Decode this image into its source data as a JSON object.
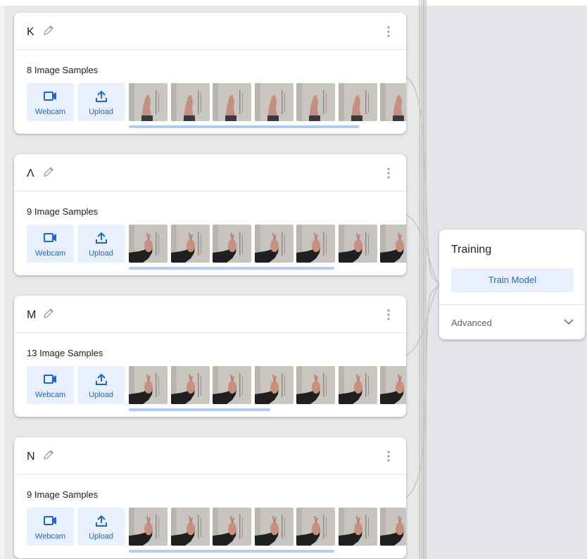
{
  "classes": [
    {
      "name": "K",
      "samples_label": "8 Image Samples",
      "webcam_label": "Webcam",
      "upload_label": "Upload",
      "thumb_count": 7,
      "scroll_progress": 0.83,
      "thumb_bg": "#c9c6c2",
      "sleeve": "#3a3a3a"
    },
    {
      "name": "Λ",
      "samples_label": "9 Image Samples",
      "webcam_label": "Webcam",
      "upload_label": "Upload",
      "thumb_count": 7,
      "scroll_progress": 0.74,
      "thumb_bg": "#c7c4bf",
      "sleeve": "#1f1f1f"
    },
    {
      "name": "M",
      "samples_label": "13 Image Samples",
      "webcam_label": "Webcam",
      "upload_label": "Upload",
      "thumb_count": 7,
      "scroll_progress": 0.51,
      "thumb_bg": "#c9c6c0",
      "sleeve": "#1f1f1f"
    },
    {
      "name": "N",
      "samples_label": "9 Image Samples",
      "webcam_label": "Webcam",
      "upload_label": "Upload",
      "thumb_count": 7,
      "scroll_progress": 0.74,
      "thumb_bg": "#c8c5c0",
      "sleeve": "#1f1f1f"
    }
  ],
  "training": {
    "title": "Training",
    "train_button_label": "Train Model",
    "advanced_label": "Advanced"
  },
  "icons": {
    "edit": "pencil-icon",
    "menu": "more-vert-icon",
    "webcam": "videocam-icon",
    "upload": "upload-icon",
    "expand": "chevron-down-icon"
  },
  "colors": {
    "accent": "#1967d2",
    "accent_bg": "#e8f0fe",
    "scroll_thumb": "#aecbfa",
    "connector": "#c6c6c8",
    "canvas": "#e8e8ea"
  }
}
